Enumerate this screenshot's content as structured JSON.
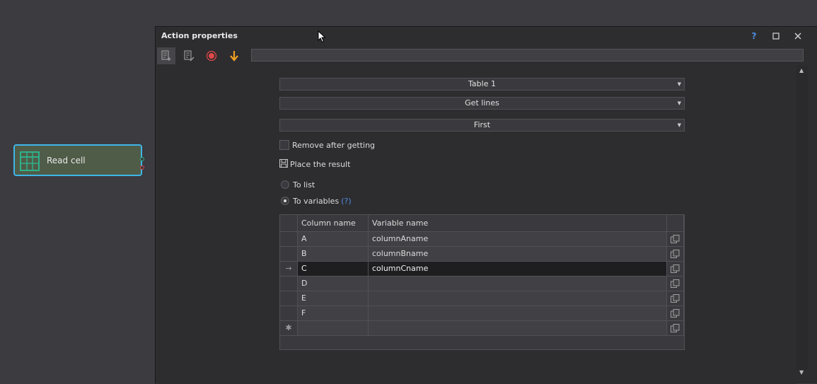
{
  "node": {
    "label": "Read cell",
    "border_color": "#3fb6e8",
    "fill_color": "#4f5c48",
    "icon": "table-icon"
  },
  "dialog": {
    "title": "Action properties",
    "controls": {
      "help": "?",
      "maximize": "☐",
      "close": "✕"
    },
    "toolbar": {
      "icons": [
        "add-action-icon",
        "edit-action-icon",
        "record-icon",
        "move-down-icon"
      ],
      "address_value": ""
    },
    "table_select": "Table 1",
    "operation_select": "Get lines",
    "position_select": "First",
    "remove_after_getting": {
      "label": "Remove after getting",
      "checked": false
    },
    "place_result_label": "Place the result",
    "to_list": {
      "label": "To list",
      "checked": false
    },
    "to_variables": {
      "label": "To variables",
      "help": "(?)",
      "checked": true
    },
    "grid": {
      "columns": [
        "Column name",
        "Variable name"
      ],
      "current_marker": "→",
      "new_row_marker": "✱",
      "rows": [
        {
          "column": "A",
          "variable": "columnAname"
        },
        {
          "column": "B",
          "variable": "columnBname"
        },
        {
          "column": "C",
          "variable": "columnCname"
        },
        {
          "column": "D",
          "variable": ""
        },
        {
          "column": "E",
          "variable": ""
        },
        {
          "column": "F",
          "variable": ""
        }
      ]
    }
  }
}
